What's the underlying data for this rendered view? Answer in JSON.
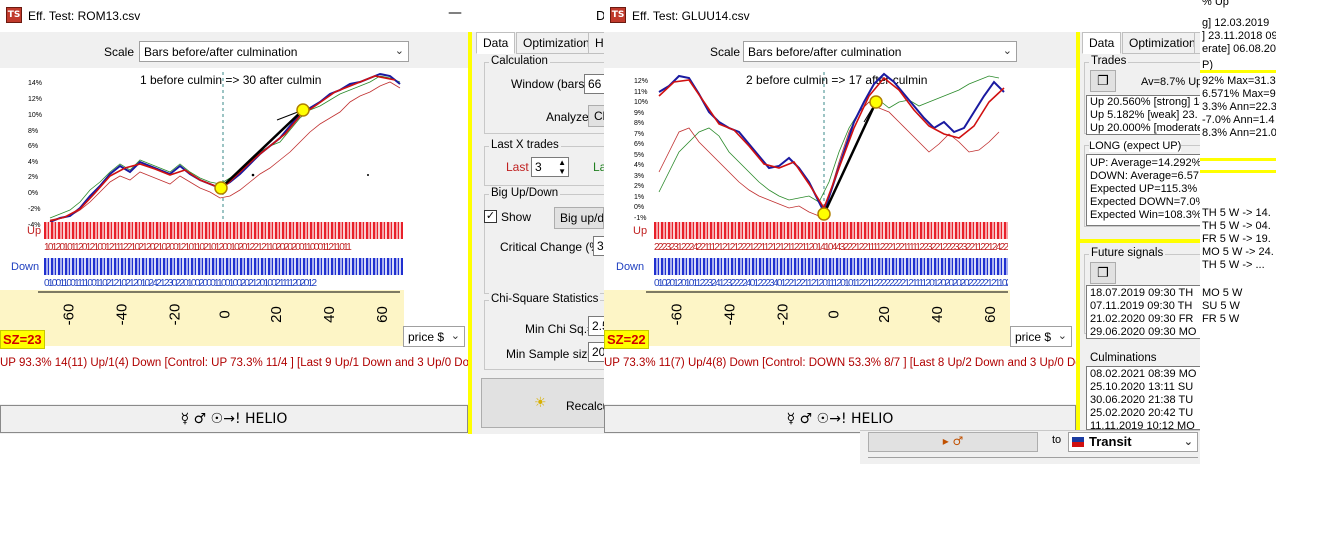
{
  "left_window": {
    "title": "Eff. Test: ROM13.csv",
    "scale_label": "Scale",
    "scale_value": "Bars before/after culmination",
    "chart_caption": "1 before culmin => 30 after culmin",
    "y_ticks": [
      "14%",
      "12%",
      "10%",
      "8%",
      "6%",
      "4%",
      "2%",
      "0%",
      "-2%",
      "-4%"
    ],
    "x_ticks": [
      "-60",
      "-40",
      "-20",
      "0",
      "20",
      "40",
      "60"
    ],
    "up_label": "Up",
    "down_label": "Down",
    "up_digits": "101201011201210012111221021202102001210110210120010201221211020202001100011211011",
    "down_digits": "010011001111001102121021201024212302201002000110010020212010021111202012",
    "sz": "SZ=23",
    "price_select": "price $",
    "status": "UP 93.3%  14(11) Up/1(4) Down [Control: UP 73.3%  11/4 ] [Last 9 Up/1 Down and 3 Up/0 Down]",
    "helio_button": "☿ ♂ ☉→!  HELIO",
    "minimize_glyph": "—"
  },
  "right_window": {
    "title": "Eff. Test: GLUU14.csv",
    "scale_label": "Scale",
    "scale_value": "Bars before/after culmination",
    "chart_caption": "2 before culmin => 17 after culmin",
    "y_ticks": [
      "12%",
      "11%",
      "10%",
      "9%",
      "8%",
      "7%",
      "6%",
      "5%",
      "4%",
      "3%",
      "2%",
      "1%",
      "0%",
      "-1%"
    ],
    "x_ticks": [
      "-60",
      "-40",
      "-20",
      "0",
      "20",
      "40",
      "60"
    ],
    "up_label": "Up",
    "down_label": "Down",
    "up_digits": "22232312224221112121212221221121212112211201410443222122111122212211111223221222323221122124222210",
    "down_digits": "0102012010112232412322224012223401221221121201112010112211222222221211112012020202022222121102",
    "sz": "SZ=22",
    "price_select": "price $",
    "status": "UP 73.3%  11(7) Up/4(8) Down [Control: DOWN 53.3%  8/7 ] [Last 8 Up/2 Down and 3 Up/0 Down]",
    "helio_button": "☿ ♂ ☉→!  HELIO",
    "minimize_glyph": "—"
  },
  "mid_panel": {
    "tab_data": "Data",
    "tab_optimization": "Optimization",
    "tab_he": "He",
    "calc_title": "Calculation",
    "window_label": "Window (bars)",
    "window_value": "66",
    "analyze_label": "Analyze",
    "analyze_value": "Cl",
    "lastx_title": "Last X trades",
    "last_label": "Last",
    "last_value": "3",
    "la_label": "La",
    "bigupdown_title": "Big Up/Down",
    "show_label": "Show",
    "bigup_button": "Big up/do",
    "critical_label": "Critical Change (%)",
    "critical_value": "3",
    "chisq_title": "Chi-Square Statistics",
    "minchi_label": "Min Chi Sq.=",
    "minchi_value": "2.5",
    "minsample_label": "Min Sample size=",
    "minsample_value": "20",
    "recalc_button": "Recalcula"
  },
  "right_panel": {
    "tab_data": "Data",
    "tab_optimization": "Optimization",
    "tab_he": "He",
    "trades_title": "Trades",
    "av_text": "Av=8.7% Up",
    "trade_rows": [
      "Up 20.560% [strong]  14",
      "Up 5.182% [weak]  23.",
      "Up 20.000% [moderate]"
    ],
    "long_title": "LONG (expect UP)",
    "long_rows": [
      "UP: Average=14.292%",
      "DOWN: Average=6.57",
      "Expected UP=115.3%",
      "Expected DOWN=7.0%",
      "Expected Win=108.3%"
    ],
    "future_title": "Future signals",
    "future_rows": [
      "18.07.2019  09:30 TH",
      "07.11.2019  09:30 TH",
      "21.02.2020  09:30 FR",
      "29.06.2020  09:30 MO"
    ],
    "culm_title": "Culminations",
    "culm_rows": [
      "08.02.2021  08:39 MO",
      "25.10.2020  13:11 SU",
      "30.06.2020  21:38 TU",
      "25.02.2020  20:42 TU",
      "11.11.2019  10:12 MO"
    ]
  },
  "far_right": {
    "top_text": "% Up",
    "top_rows": [
      "g]  12.03.2019",
      "]  23.11.2018  09",
      "erate]  06.08.20"
    ],
    "p_text": "P)",
    "stat_rows": [
      "92%  Max=31.3",
      "6.571%  Max=9",
      "3.3%  Ann=22.3",
      "-7.0%  Ann=1.4",
      "8.3%  Ann=21.0"
    ],
    "fut_rows": [
      "TH  5 W -> 14.",
      "TH  5 W -> 04.",
      "FR  5 W -> 19.",
      "MO  5 W -> 24.",
      "TH  5 W -> ..."
    ],
    "culm_rows": [
      "MO  5 W",
      "SU  5 W",
      "FR  5 W"
    ]
  },
  "bottom_strip": {
    "mars_button": "▸ ♂",
    "to_label": "to",
    "transit_value": "Transit"
  },
  "colors": {
    "up_band": "#e8202a",
    "down_band": "#2030d0",
    "axis_bg": "#fdf5c6",
    "yellow": "#ffff00",
    "status_red": "#b00000"
  }
}
